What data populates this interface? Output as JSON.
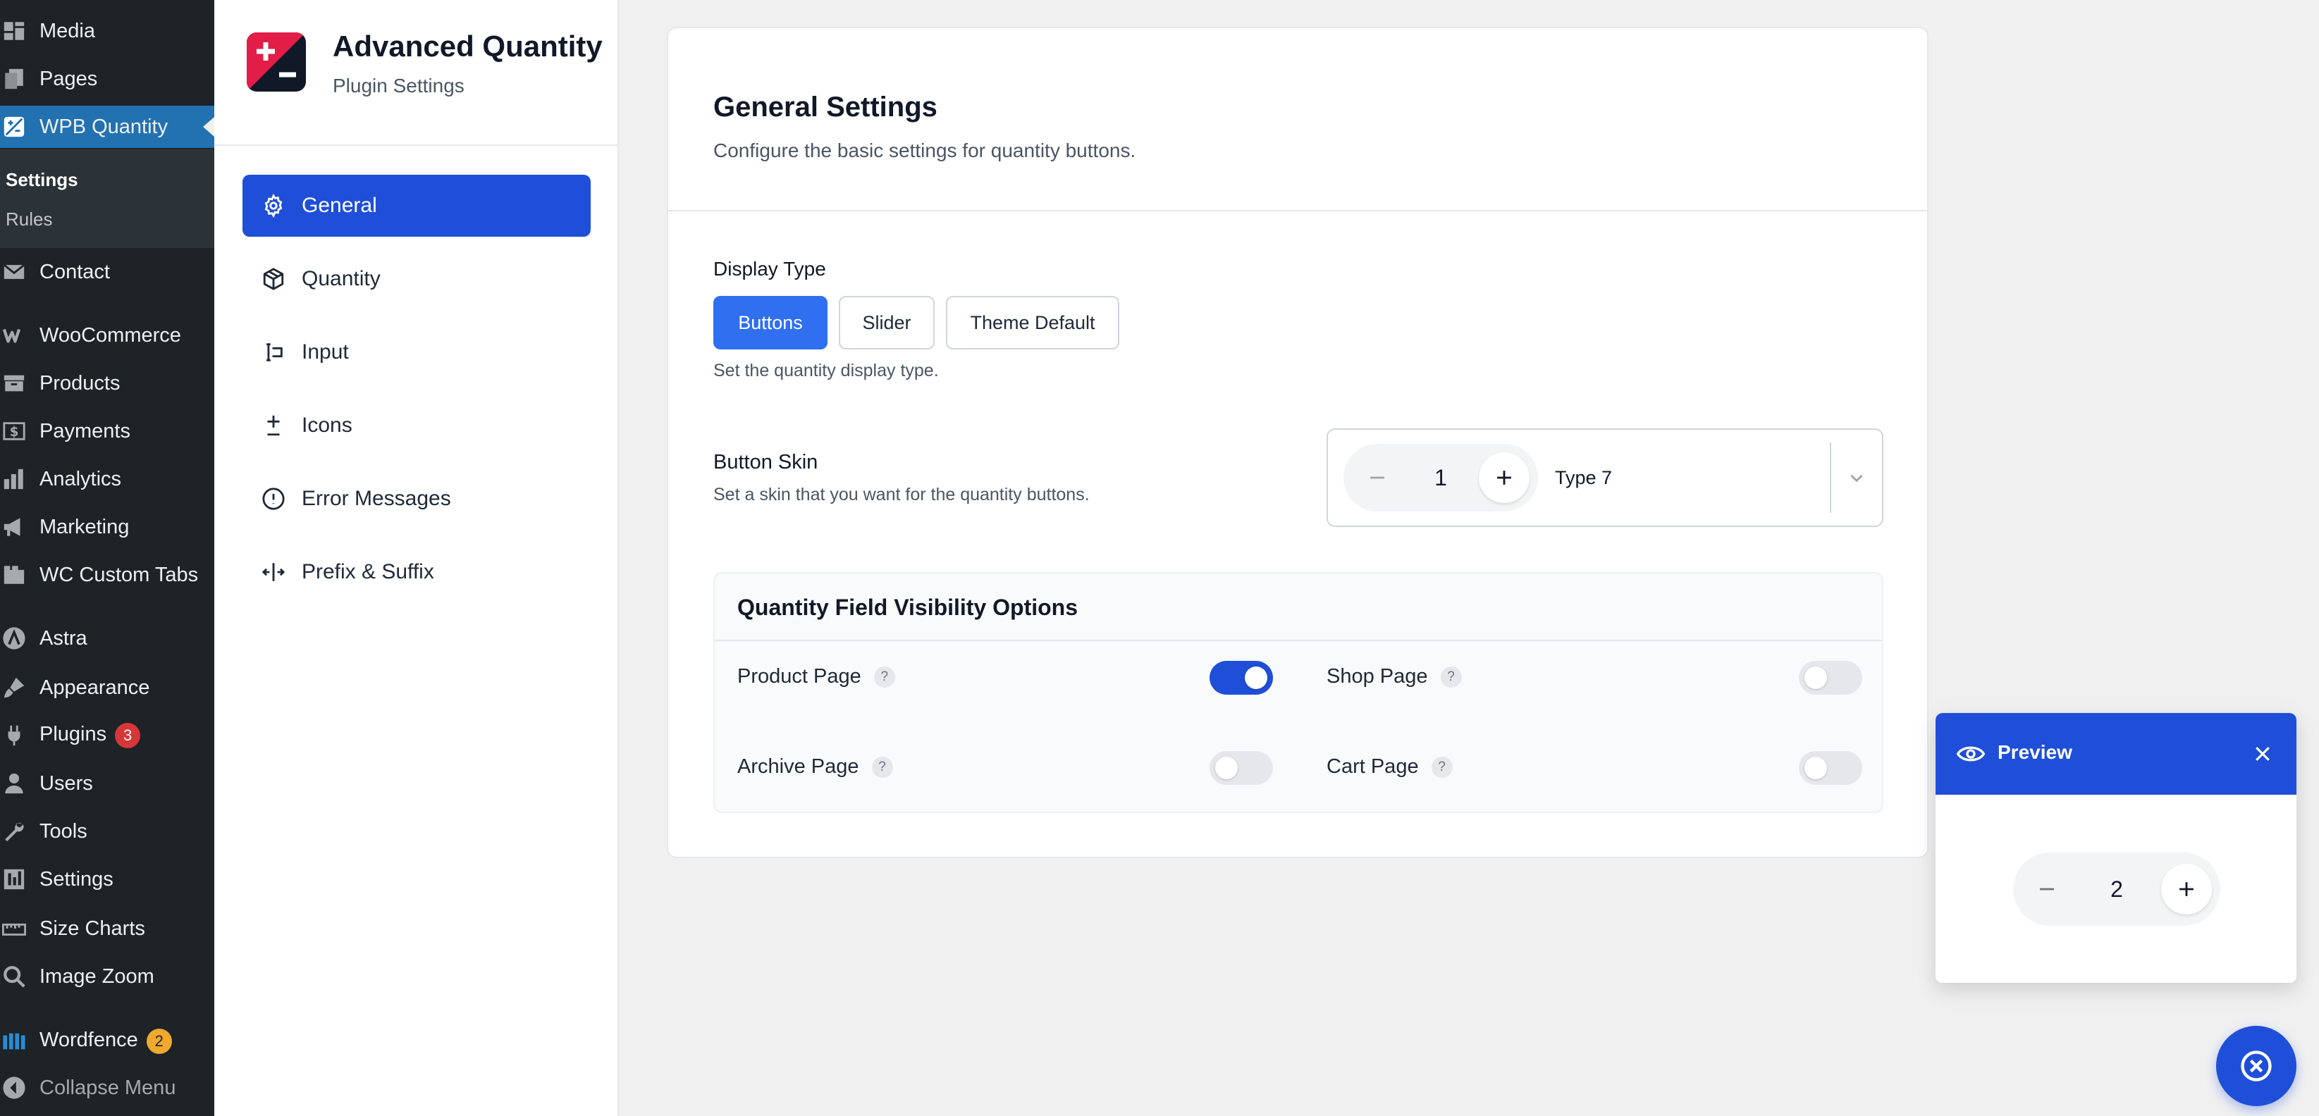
{
  "colors": {
    "accent": "#1f4fd8",
    "wp_sidebar": "#1d2327",
    "wp_active": "#2271b1",
    "badge_red": "#d63638",
    "badge_orange": "#f0a92f"
  },
  "wp_menu": {
    "items": [
      {
        "label": "Media",
        "icon": "media-icon"
      },
      {
        "label": "Pages",
        "icon": "pages-icon"
      },
      {
        "label": "WPB Quantity",
        "icon": "wpb-quantity-icon",
        "active": true
      },
      {
        "label": "Contact",
        "icon": "mail-icon"
      },
      {
        "label": "WooCommerce",
        "icon": "woocommerce-icon"
      },
      {
        "label": "Products",
        "icon": "archive-icon"
      },
      {
        "label": "Payments",
        "icon": "dollar-icon"
      },
      {
        "label": "Analytics",
        "icon": "bar-chart-icon"
      },
      {
        "label": "Marketing",
        "icon": "megaphone-icon"
      },
      {
        "label": "WC Custom Tabs",
        "icon": "tabs-icon"
      },
      {
        "label": "Astra",
        "icon": "astra-icon"
      },
      {
        "label": "Appearance",
        "icon": "brush-icon"
      },
      {
        "label": "Plugins",
        "icon": "plug-icon",
        "badge": "3"
      },
      {
        "label": "Users",
        "icon": "user-icon"
      },
      {
        "label": "Tools",
        "icon": "wrench-icon"
      },
      {
        "label": "Settings",
        "icon": "settings-icon"
      },
      {
        "label": "Size Charts",
        "icon": "ruler-icon"
      },
      {
        "label": "Image Zoom",
        "icon": "magnifier-icon"
      },
      {
        "label": "Wordfence",
        "icon": "wordfence-icon",
        "badge": "2"
      },
      {
        "label": "Collapse Menu",
        "icon": "collapse-icon"
      }
    ],
    "submenu": [
      {
        "label": "Settings",
        "current": true
      },
      {
        "label": "Rules"
      }
    ]
  },
  "plugin": {
    "title": "Advanced Quantity",
    "subtitle": "Plugin Settings",
    "nav": [
      {
        "label": "General",
        "icon": "gear-icon",
        "active": true
      },
      {
        "label": "Quantity",
        "icon": "package-icon"
      },
      {
        "label": "Input",
        "icon": "text-cursor-input-icon"
      },
      {
        "label": "Icons",
        "icon": "plus-minus-icon"
      },
      {
        "label": "Error Messages",
        "icon": "alert-circle-icon"
      },
      {
        "label": "Prefix & Suffix",
        "icon": "move-horizontal-icon"
      }
    ]
  },
  "general": {
    "title": "General Settings",
    "description": "Configure the basic settings for quantity buttons.",
    "display_type": {
      "label": "Display Type",
      "options": [
        "Buttons",
        "Slider",
        "Theme Default"
      ],
      "selected": "Buttons",
      "help": "Set the quantity display type."
    },
    "button_skin": {
      "label": "Button Skin",
      "help": "Set a skin that you want for the quantity buttons.",
      "value": "Type 7",
      "sample_quantity": "1"
    },
    "visibility": {
      "title": "Quantity Field Visibility Options",
      "help_glyph": "?",
      "options": [
        {
          "label": "Product Page",
          "enabled": true
        },
        {
          "label": "Shop Page",
          "enabled": false
        },
        {
          "label": "Archive Page",
          "enabled": false
        },
        {
          "label": "Cart Page",
          "enabled": false
        }
      ]
    }
  },
  "preview": {
    "title": "Preview",
    "quantity": "2"
  }
}
